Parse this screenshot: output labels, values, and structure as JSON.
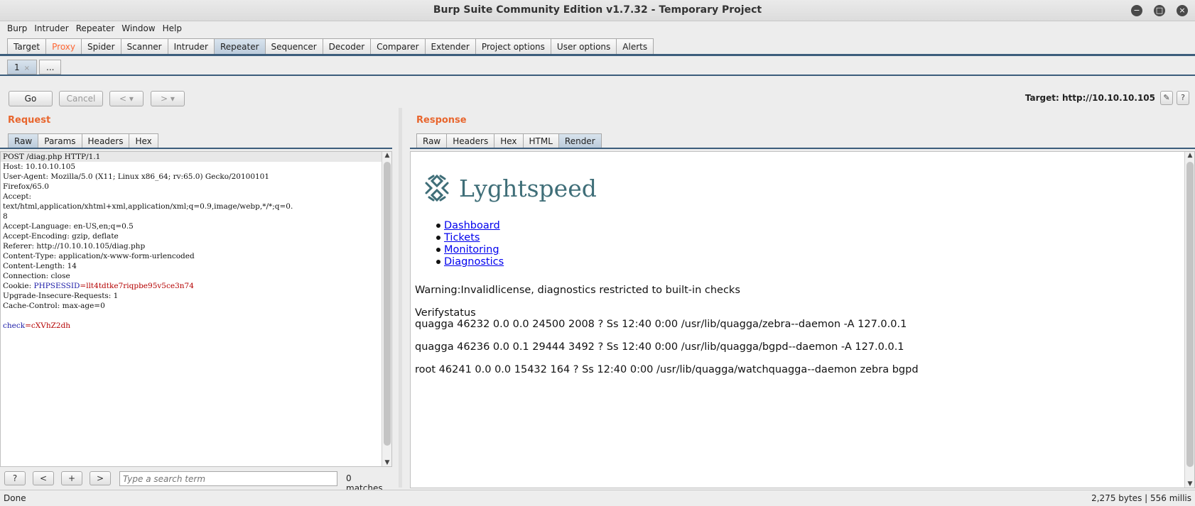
{
  "window": {
    "title": "Burp Suite Community Edition v1.7.32 - Temporary Project"
  },
  "menu": [
    "Burp",
    "Intruder",
    "Repeater",
    "Window",
    "Help"
  ],
  "main_tabs": [
    "Target",
    "Proxy",
    "Spider",
    "Scanner",
    "Intruder",
    "Repeater",
    "Sequencer",
    "Decoder",
    "Comparer",
    "Extender",
    "Project options",
    "User options",
    "Alerts"
  ],
  "repeater_tabs": {
    "tab1": "1",
    "more": "..."
  },
  "toolbar": {
    "go": "Go",
    "cancel": "Cancel",
    "back": "<",
    "forward": ">",
    "target": "Target: http://10.10.10.105"
  },
  "request": {
    "title": "Request",
    "tabs": [
      "Raw",
      "Params",
      "Headers",
      "Hex"
    ],
    "lines": [
      "POST /diag.php HTTP/1.1",
      "Host: 10.10.10.105",
      "User-Agent: Mozilla/5.0 (X11; Linux x86_64; rv:65.0) Gecko/20100101",
      "Firefox/65.0",
      "Accept:",
      "text/html,application/xhtml+xml,application/xml;q=0.9,image/webp,*/*;q=0.",
      "8",
      "Accept-Language: en-US,en;q=0.5",
      "Accept-Encoding: gzip, deflate",
      "Referer: http://10.10.10.105/diag.php",
      "Content-Type: application/x-www-form-urlencoded",
      "Content-Length: 14",
      "Connection: close"
    ],
    "cookie_prefix": "Cookie: ",
    "cookie_name": "PHPSESSID",
    "cookie_value": "=llt4tdtke7riqpbe95v5ce3n74",
    "lines_after": [
      "Upgrade-Insecure-Requests: 1",
      "Cache-Control: max-age=0"
    ],
    "body_key": "check",
    "body_value": "=cXVhZ2dh"
  },
  "search": {
    "help": "?",
    "prev": "<",
    "add": "+",
    "next": ">",
    "placeholder": "Type a search term",
    "matches": "0 matches"
  },
  "response": {
    "title": "Response",
    "tabs": [
      "Raw",
      "Headers",
      "Hex",
      "HTML",
      "Render"
    ],
    "brand": "Lyghtspeed",
    "nav": [
      "Dashboard",
      "Tickets",
      "Monitoring",
      "Diagnostics"
    ],
    "warning": "Warning:Invalidlicense, diagnostics restricted to built-in checks",
    "verify": "Verifystatus",
    "proc1": "quagga 46232 0.0 0.0 24500 2008 ? Ss 12:40 0:00 /usr/lib/quagga/zebra--daemon -A 127.0.0.1",
    "proc2": "quagga 46236 0.0 0.1 29444 3492 ? Ss 12:40 0:00 /usr/lib/quagga/bgpd--daemon -A 127.0.0.1",
    "proc3": "root 46241 0.0 0.0 15432 164 ? Ss 12:40 0:00 /usr/lib/quagga/watchquagga--daemon zebra bgpd"
  },
  "status": {
    "left": "Done",
    "right": "2,275 bytes | 556 millis"
  },
  "colors": {
    "accent": "#e8662e",
    "tab_rule": "#3c5d7c",
    "brand": "#3f6e78",
    "link": "#0000ee"
  }
}
